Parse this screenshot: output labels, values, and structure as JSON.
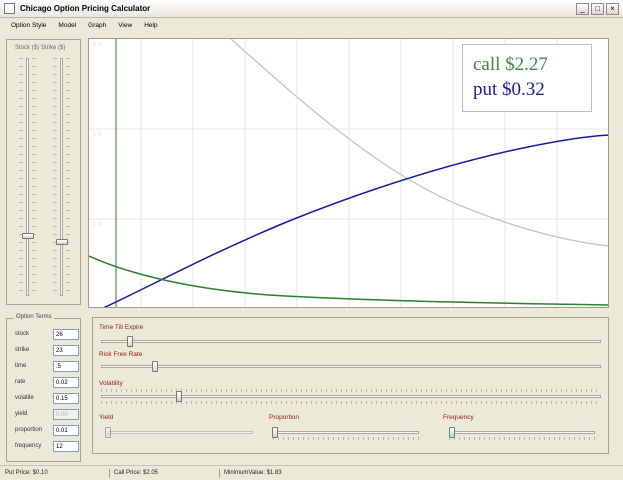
{
  "window": {
    "title": "Chicago Option Pricing Calculator",
    "min": "_",
    "max": "□",
    "close": "×"
  },
  "menu": [
    "Option Style",
    "Model",
    "Graph",
    "View",
    "Help"
  ],
  "sliders": {
    "stock_label": "Stock ($)",
    "strike_label": "Strike ($)"
  },
  "terms": {
    "title": "Option Terms",
    "rows": [
      {
        "label": "stock",
        "value": "26",
        "enabled": true
      },
      {
        "label": "strike",
        "value": "23",
        "enabled": true
      },
      {
        "label": "time",
        "value": ".5",
        "enabled": true
      },
      {
        "label": "rate",
        "value": "0.02",
        "enabled": true
      },
      {
        "label": "volatile",
        "value": "0.15",
        "enabled": true
      },
      {
        "label": "yield",
        "value": "0.00",
        "enabled": false
      },
      {
        "label": "proportion",
        "value": "0.01",
        "enabled": true
      },
      {
        "label": "frequency",
        "value": "12",
        "enabled": true
      }
    ]
  },
  "plot": {
    "call_text": "call $2.27",
    "put_text": "put $0.32",
    "axis_labels": [
      "2.0",
      "1.5",
      "1.0"
    ],
    "colors": {
      "call": "#1a1a9e",
      "put": "#2e7d2e",
      "decay": "#c9c2b4",
      "grid": "#e6e6e6"
    }
  },
  "controls": {
    "time_label": "Time Till Expire",
    "rate_label": "Risk Free Rate",
    "vol_label": "Volatility",
    "yield_label": "Yield",
    "proportion_label": "Proportion",
    "frequency_label": "Frequency"
  },
  "status": {
    "put": "Put Price:  $0.10",
    "call": "Call Price:  $2.05",
    "min": "MinimumValue:  $1.83"
  }
}
